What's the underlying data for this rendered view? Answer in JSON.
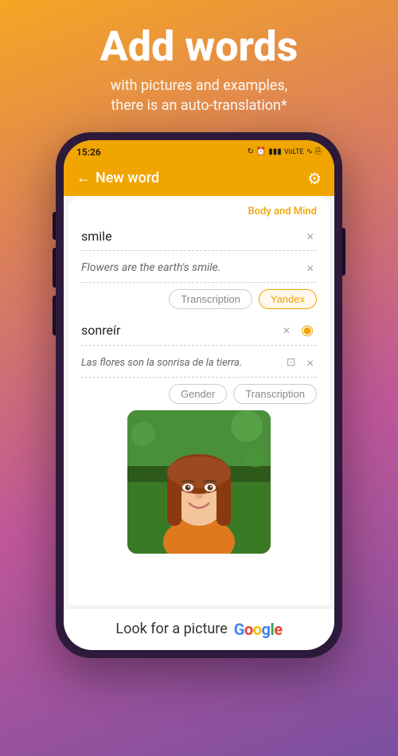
{
  "header": {
    "title": "Add words",
    "subtitle_line1": "with pictures and examples,",
    "subtitle_line2": "there is an auto-translation*"
  },
  "status_bar": {
    "time": "15:26",
    "icons": "🔵 ⏰ ▮▮▮ VoLTE WiFi 🔋"
  },
  "nav": {
    "back_arrow": "←",
    "title": "New word",
    "gear_icon": "⚙"
  },
  "category": "Body and Mind",
  "word_section": {
    "word": "smile",
    "example": "Flowers are the earth's smile.",
    "transcription_btn": "Transcription",
    "yandex_btn": "Yandex"
  },
  "translation_section": {
    "translation": "sonreír",
    "example": "Las flores son la sonrisa de la tierra.",
    "gender_btn": "Gender",
    "transcription_btn": "Transcription"
  },
  "bottom_bar": {
    "text": "Look for a picture",
    "google": "Google"
  },
  "icons": {
    "close": "×",
    "copy": "⊡",
    "sound": "◉",
    "arrow_back": "←",
    "gear": "⚙"
  }
}
